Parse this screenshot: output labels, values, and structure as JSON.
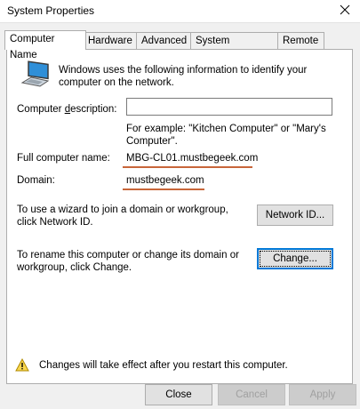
{
  "window": {
    "title": "System Properties",
    "close_icon": "close-icon"
  },
  "tabs": [
    {
      "label": "Computer Name",
      "active": true
    },
    {
      "label": "Hardware",
      "active": false
    },
    {
      "label": "Advanced",
      "active": false
    },
    {
      "label": "System Protection",
      "active": false
    },
    {
      "label": "Remote",
      "active": false
    }
  ],
  "computer_name": {
    "intro": "Windows uses the following information to identify your computer on the network.",
    "description_label": "Computer description:",
    "description_value": "",
    "description_hint": "For example: \"Kitchen Computer\" or \"Mary's Computer\".",
    "full_name_label": "Full computer name:",
    "full_name_value": "MBG-CL01.mustbegeek.com",
    "domain_label": "Domain:",
    "domain_value": "mustbegeek.com",
    "network_id_text": "To use a wizard to join a domain or workgroup, click Network ID.",
    "network_id_button": "Network ID...",
    "rename_text": "To rename this computer or change its domain or workgroup, click Change.",
    "change_button": "Change...",
    "warning_text": "Changes will take effect after you restart this computer.",
    "annotation_color": "#c8663a"
  },
  "footer": {
    "close_label": "Close",
    "cancel_label": "Cancel",
    "apply_label": "Apply"
  }
}
